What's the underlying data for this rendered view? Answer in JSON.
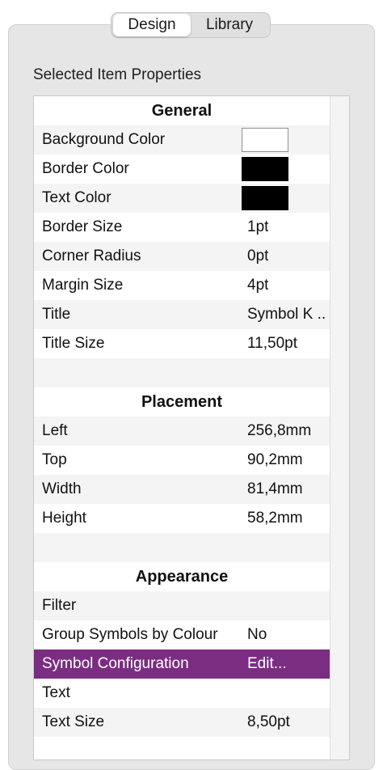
{
  "tabs": {
    "design": "Design",
    "library": "Library"
  },
  "panel_title": "Selected Item Properties",
  "colors": {
    "selected_row": "#7b2d82",
    "swatch_background": "#ffffff",
    "swatch_border": "#000000",
    "swatch_text": "#000000"
  },
  "general": {
    "header": "General",
    "rows": [
      {
        "name": "Background Color",
        "value": ""
      },
      {
        "name": "Border Color",
        "value": ""
      },
      {
        "name": "Text Color",
        "value": ""
      },
      {
        "name": "Border Size",
        "value": "1pt"
      },
      {
        "name": "Corner Radius",
        "value": "0pt"
      },
      {
        "name": "Margin Size",
        "value": "4pt"
      },
      {
        "name": "Title",
        "value": "Symbol K .."
      },
      {
        "name": "Title Size",
        "value": "11,50pt"
      }
    ]
  },
  "placement": {
    "header": "Placement",
    "rows": [
      {
        "name": "Left",
        "value": "256,8mm"
      },
      {
        "name": "Top",
        "value": "90,2mm"
      },
      {
        "name": "Width",
        "value": "81,4mm"
      },
      {
        "name": "Height",
        "value": "58,2mm"
      }
    ]
  },
  "appearance": {
    "header": "Appearance",
    "rows": [
      {
        "name": "Filter",
        "value": ""
      },
      {
        "name": "Group Symbols by Colour",
        "value": "No"
      },
      {
        "name": "Symbol Configuration",
        "value": "Edit..."
      },
      {
        "name": "Text",
        "value": ""
      },
      {
        "name": "Text Size",
        "value": "8,50pt"
      }
    ]
  }
}
